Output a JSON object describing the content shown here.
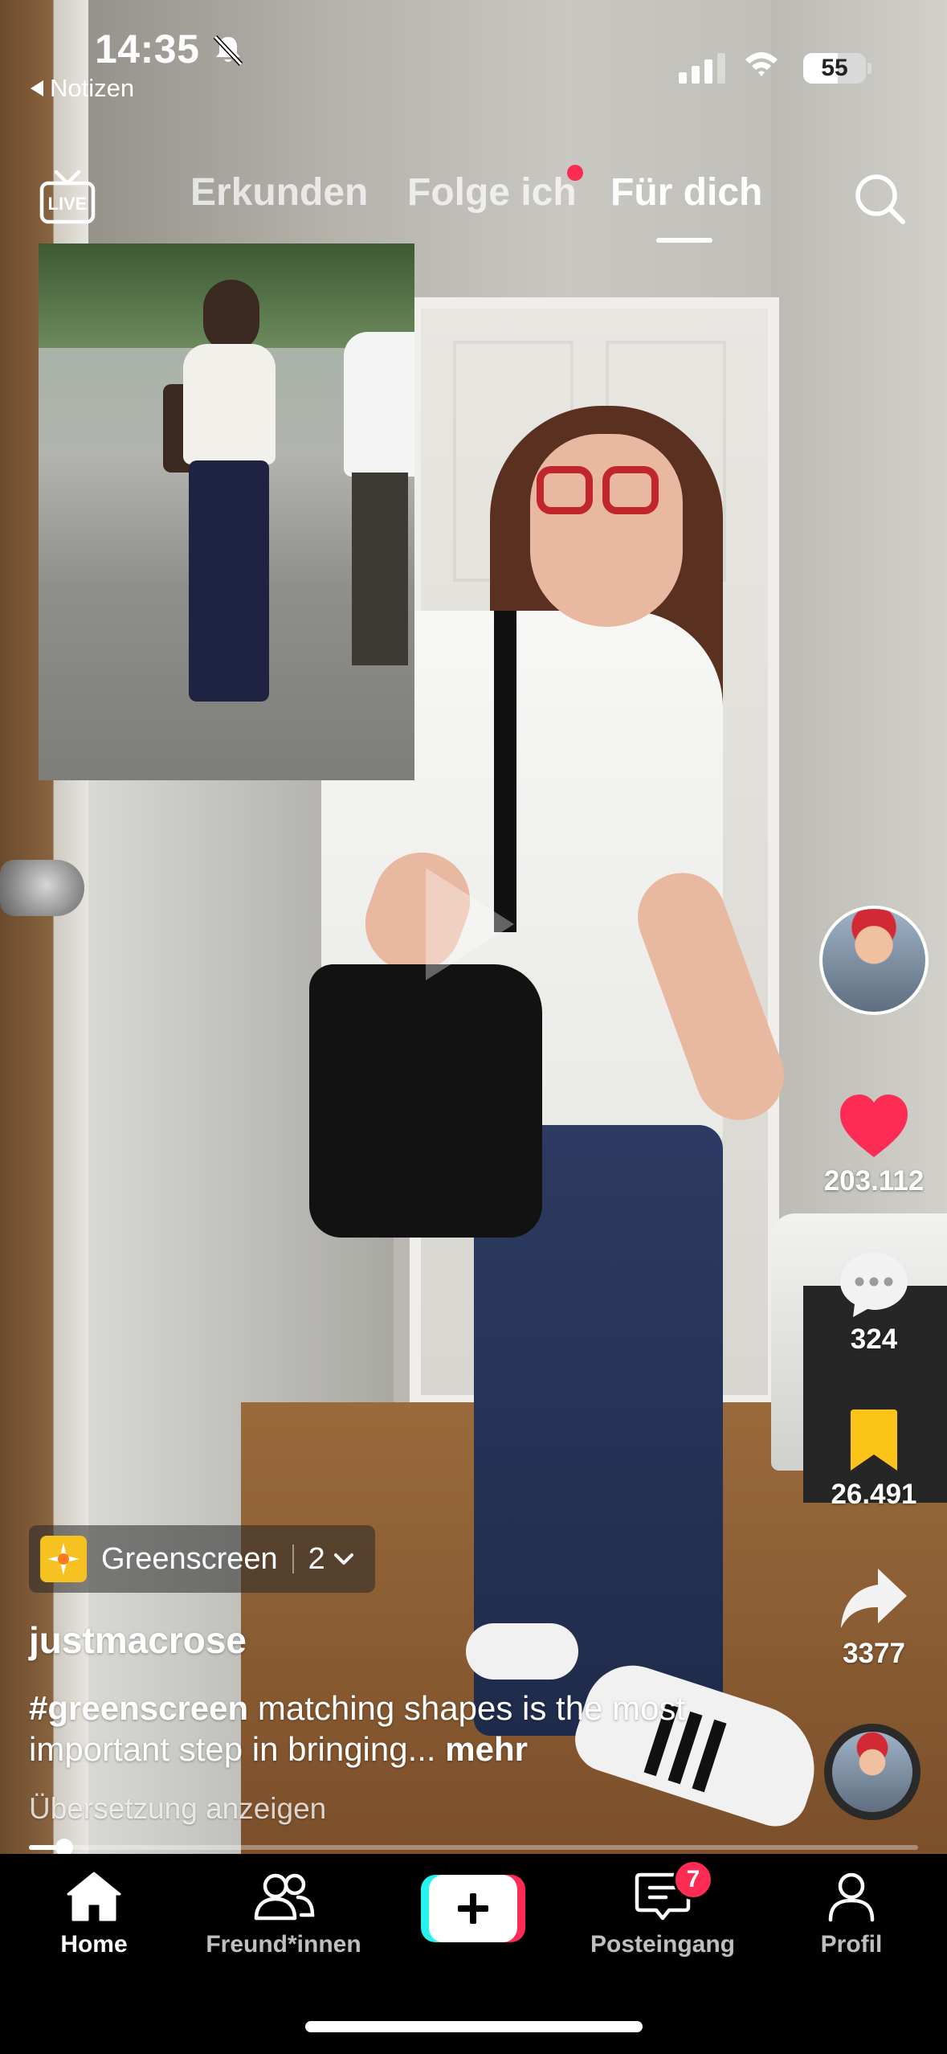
{
  "status_bar": {
    "time": "14:35",
    "back_label": "Notizen",
    "battery": "55",
    "battery_level_percent": 55,
    "icons": [
      "bell-slash-icon",
      "cellular-signal-icon",
      "wifi-icon",
      "battery-icon"
    ]
  },
  "top_nav": {
    "live_icon": "live-tv-icon",
    "tabs": [
      {
        "label": "Erkunden",
        "active": false
      },
      {
        "label": "Folge ich",
        "active": false,
        "has_dot": true
      },
      {
        "label": "Für dich",
        "active": true
      }
    ],
    "search_icon": "search-icon"
  },
  "actions": {
    "likes": "203.112",
    "comments": "324",
    "saves": "26.491",
    "shares": "3377",
    "colors": {
      "like": "#fe2c55",
      "save": "#fcc419"
    }
  },
  "post": {
    "effect_name": "Greenscreen",
    "effect_count": "2",
    "username": "justmacrose",
    "hashtag": "#greenscreen",
    "caption": "matching shapes is the most important step in bringing...",
    "more_label": "mehr",
    "translate_label": "Übersetzung anzeigen",
    "progress_fraction": 0.04
  },
  "bottom_nav": {
    "items": [
      {
        "label": "Home",
        "icon": "home-icon",
        "active": true
      },
      {
        "label": "Freund*innen",
        "icon": "friends-icon",
        "active": false
      },
      {
        "label": "Posteingang",
        "icon": "inbox-icon",
        "active": false,
        "badge": "7"
      },
      {
        "label": "Profil",
        "icon": "profile-icon",
        "active": false
      }
    ],
    "create_icon": "plus-icon"
  },
  "colors": {
    "accent_red": "#fe2c55",
    "accent_cyan": "#25f4ee"
  }
}
